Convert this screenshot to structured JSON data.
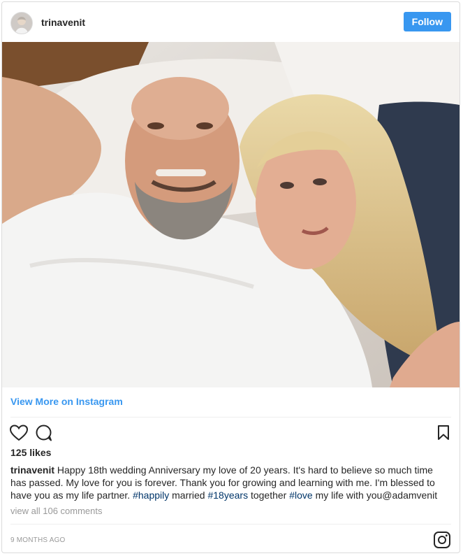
{
  "header": {
    "username": "trinavenit",
    "follow_label": "Follow"
  },
  "photo": {
    "description_icon": "post-photo"
  },
  "links": {
    "view_more": "View More on Instagram"
  },
  "engagement": {
    "likes": "125 likes"
  },
  "caption": {
    "username": "trinavenit",
    "text_before": " Happy 18th wedding Anniversary my love of 20 years. It's hard to believe so much time has passed. My love for you is forever. Thank you for growing and learning with me. I'm blessed to have you as my life partner. ",
    "tag1": "#happily",
    "mid1": " married ",
    "tag2": "#18years",
    "mid2": " together ",
    "tag3": "#love",
    "end": " my life with you@adamvenit"
  },
  "comments": {
    "view_all": "view all 106 comments"
  },
  "footer": {
    "timestamp": "9 MONTHS AGO"
  },
  "colors": {
    "accent": "#3897f0",
    "hashtag": "#003569",
    "muted": "#999999"
  }
}
